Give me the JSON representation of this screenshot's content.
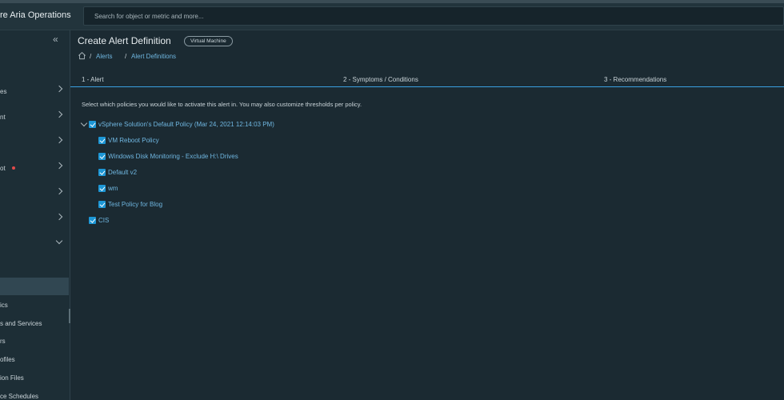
{
  "header": {
    "brand": "re Aria Operations",
    "search_placeholder": "Search for object or metric and more..."
  },
  "sidebar": {
    "collapse_icon": "double-chevron-left-icon",
    "items": [
      {
        "label": "es"
      },
      {
        "label": "nt"
      },
      {
        "label": ""
      },
      {
        "label": "ot"
      },
      {
        "label": ""
      },
      {
        "label": ""
      },
      {
        "label": ""
      }
    ],
    "sub_items": [
      {
        "label": "ics"
      },
      {
        "label": "s and Services"
      },
      {
        "label": "rs"
      },
      {
        "label": "ofiles"
      },
      {
        "label": "ion Files"
      },
      {
        "label": "ce Schedules"
      }
    ],
    "notification_color": "#e34a4a"
  },
  "page": {
    "title": "Create Alert Definition",
    "badge": "Virtual Machine",
    "breadcrumb": {
      "home_icon": "home-icon",
      "items": [
        {
          "label": "Alerts"
        },
        {
          "label": "Alert Definitions"
        }
      ],
      "separator": "/"
    }
  },
  "wizard": {
    "steps": [
      {
        "label": "1 - Alert"
      },
      {
        "label": "2 - Symptoms / Conditions"
      },
      {
        "label": "3 - Recommendations"
      }
    ],
    "accent_color": "#3aa0e0"
  },
  "policies": {
    "description": "Select which policies you would like to activate this alert in. You may also customize thresholds per policy.",
    "tree": [
      {
        "label": "vSphere Solution's Default Policy (Mar 24, 2021 12:14:03 PM)",
        "checked": true,
        "expanded": true,
        "children": [
          {
            "label": "VM Reboot Policy",
            "checked": true
          },
          {
            "label": "Windows Disk Monitoring - Exclude H:\\ Drives",
            "checked": true
          },
          {
            "label": "Default v2",
            "checked": true
          },
          {
            "label": "wm",
            "checked": true
          },
          {
            "label": "Test Policy for Blog",
            "checked": true
          }
        ]
      },
      {
        "label": "CIS",
        "checked": true
      }
    ],
    "checkbox_color": "#1d97d6"
  }
}
